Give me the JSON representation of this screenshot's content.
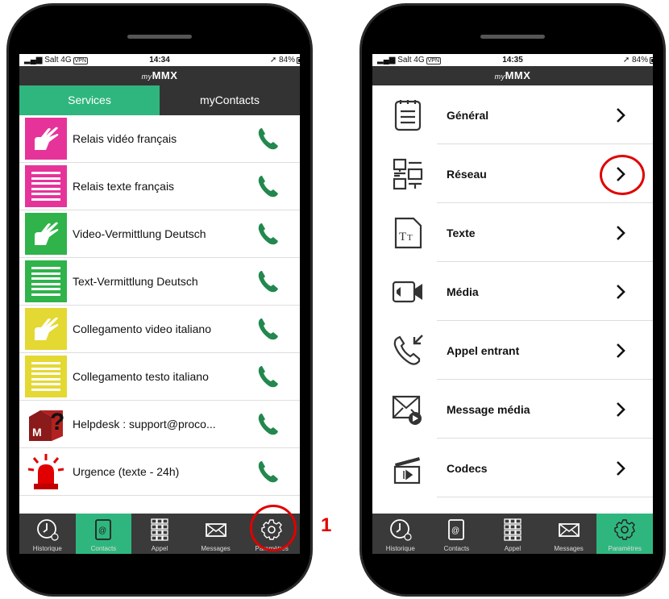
{
  "colors": {
    "accent": "#2fb67e",
    "dark_bar": "#333333",
    "highlight": "#e00000"
  },
  "left_screen": {
    "status": {
      "carrier": "Salt 4G",
      "vpn": "VPN",
      "time": "14:34",
      "battery": "84%"
    },
    "app_title_prefix": "my",
    "app_title": "MMX",
    "tabs": [
      {
        "label": "Services",
        "active": true
      },
      {
        "label": "myContacts",
        "active": false
      }
    ],
    "services": [
      {
        "label": "Relais vidéo français",
        "icon": "sign-hands-icon",
        "color": "#e6339a"
      },
      {
        "label": "Relais texte français",
        "icon": "text-lines-icon",
        "color": "#e6339a"
      },
      {
        "label": "Video-Vermittlung Deutsch",
        "icon": "sign-hands-icon",
        "color": "#2fb34a"
      },
      {
        "label": "Text-Vermittlung Deutsch",
        "icon": "text-lines-icon",
        "color": "#2fb34a"
      },
      {
        "label": "Collegamento video italiano",
        "icon": "sign-hands-icon",
        "color": "#e4d832"
      },
      {
        "label": "Collegamento testo italiano",
        "icon": "text-lines-icon",
        "color": "#e4d832"
      },
      {
        "label": "Helpdesk : support@proco...",
        "icon": "helpdesk-icon",
        "color": "#8b1a1a"
      },
      {
        "label": "Urgence (texte - 24h)",
        "icon": "siren-icon",
        "color": "#e00000"
      }
    ],
    "tabbar": [
      {
        "label": "Historique",
        "icon": "clock-icon",
        "active": false
      },
      {
        "label": "Contacts",
        "icon": "contacts-book-icon",
        "active": true
      },
      {
        "label": "Appel",
        "icon": "keypad-icon",
        "active": false
      },
      {
        "label": "Messages",
        "icon": "envelope-icon",
        "active": false
      },
      {
        "label": "Paramètres",
        "icon": "gear-icon",
        "active": false
      }
    ]
  },
  "right_screen": {
    "status": {
      "carrier": "Salt 4G",
      "vpn": "VPN",
      "time": "14:35",
      "battery": "84%"
    },
    "app_title_prefix": "my",
    "app_title": "MMX",
    "settings": [
      {
        "label": "Général",
        "icon": "notepad-icon"
      },
      {
        "label": "Réseau",
        "icon": "network-icon"
      },
      {
        "label": "Texte",
        "icon": "text-file-icon"
      },
      {
        "label": "Média",
        "icon": "video-media-icon"
      },
      {
        "label": "Appel entrant",
        "icon": "incoming-call-icon"
      },
      {
        "label": "Message média",
        "icon": "media-message-icon"
      },
      {
        "label": "Codecs",
        "icon": "clapperboard-icon"
      }
    ],
    "tabbar": [
      {
        "label": "Historique",
        "icon": "clock-icon",
        "active": false
      },
      {
        "label": "Contacts",
        "icon": "contacts-book-icon",
        "active": false
      },
      {
        "label": "Appel",
        "icon": "keypad-icon",
        "active": false
      },
      {
        "label": "Messages",
        "icon": "envelope-icon",
        "active": false
      },
      {
        "label": "Paramètres",
        "icon": "gear-icon",
        "active": true
      }
    ]
  },
  "annotation": {
    "step_number": "1"
  }
}
